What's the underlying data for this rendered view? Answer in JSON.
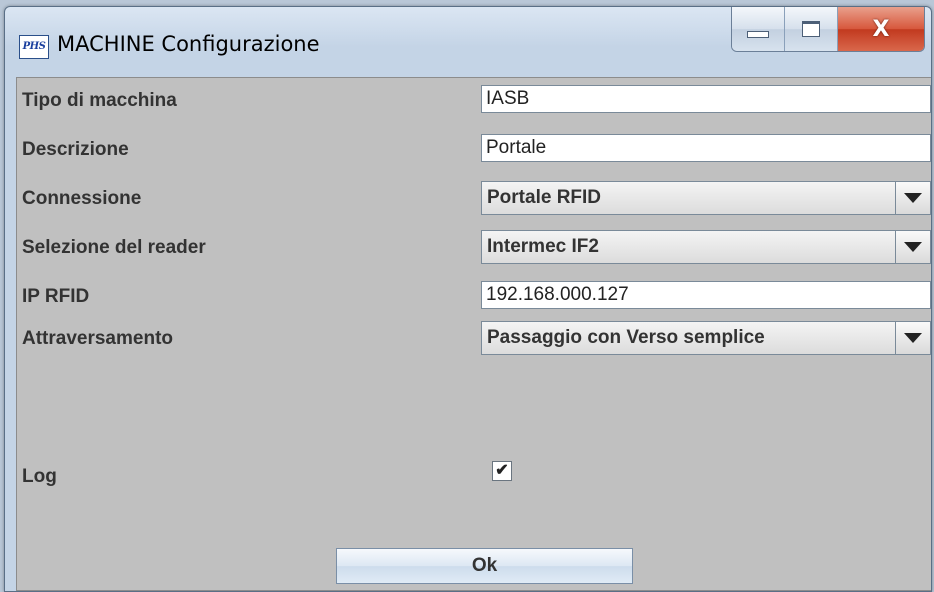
{
  "window": {
    "app_icon_text": "PHS",
    "title": "MACHINE Configurazione",
    "controls": {
      "minimize": "minimize-icon",
      "maximize": "maximize-icon",
      "close": "close-icon",
      "close_glyph": "X"
    }
  },
  "form": {
    "tipo_label": "Tipo di macchina",
    "tipo_value": "IASB",
    "descrizione_label": "Descrizione",
    "descrizione_value": "Portale",
    "connessione_label": "Connessione",
    "connessione_value": "Portale  RFID",
    "reader_label": "Selezione del reader",
    "reader_value": "Intermec  IF2",
    "ip_label": "IP RFID",
    "ip_value": "192.168.000.127",
    "attraversamento_label": "Attraversamento",
    "attraversamento_value": "Passaggio con Verso semplice",
    "log_label": "Log",
    "log_checked": true,
    "log_check_glyph": "✔"
  },
  "ok_label": "Ok",
  "icons": {
    "dropdown": "chevron-down-icon",
    "check": "check-icon"
  }
}
